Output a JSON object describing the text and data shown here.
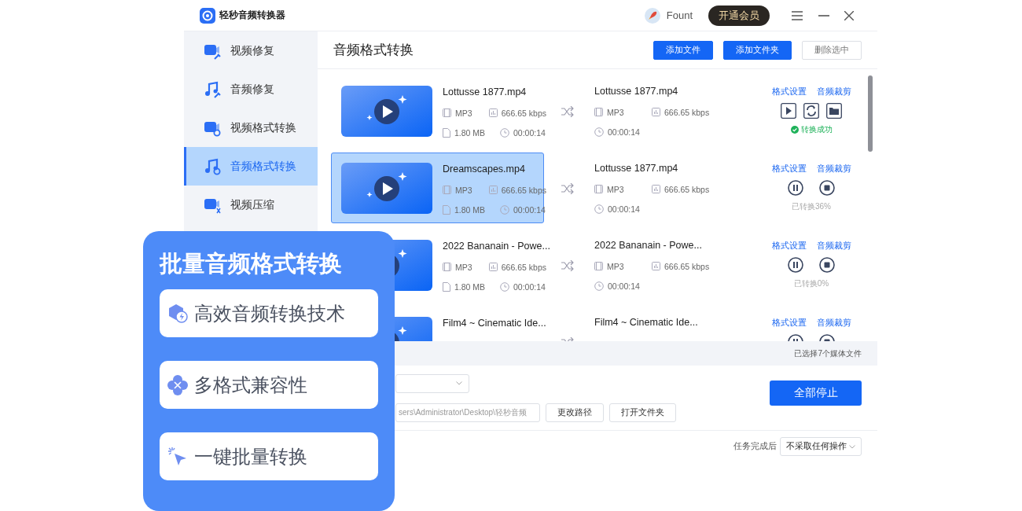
{
  "app": {
    "title": "轻秒音频转换器",
    "user": "Fount",
    "vip_button": "开通会员"
  },
  "sidebar": {
    "items": [
      {
        "label": "视频修复",
        "kind": "video-repair",
        "selected": false
      },
      {
        "label": "音频修复",
        "kind": "audio-repair",
        "selected": false
      },
      {
        "label": "视频格式转换",
        "kind": "video-convert",
        "selected": false
      },
      {
        "label": "音频格式转换",
        "kind": "audio-convert",
        "selected": true
      },
      {
        "label": "视频压缩",
        "kind": "video-compress",
        "selected": false
      }
    ]
  },
  "main": {
    "title": "音频格式转换",
    "buttons": [
      {
        "label": "添加文件",
        "kind": "primary"
      },
      {
        "label": "添加文件夹",
        "kind": "primary"
      },
      {
        "label": "删除选中",
        "kind": "outline"
      }
    ]
  },
  "files": [
    {
      "name": "Lottusse 1877.mp4",
      "format": "MP3",
      "bitrate": "666.65 kbps",
      "size": "1.80 MB",
      "duration": "00:00:14",
      "output_name": "Lottusse 1877.mp4",
      "output_format": "MP3",
      "output_bitrate": "666.65 kbps",
      "output_duration": "00:00:14",
      "links": [
        "格式设置",
        "音频裁剪"
      ],
      "kind": "done",
      "status": "转换成功",
      "selected": false
    },
    {
      "name": "Dreamscapes.mp4",
      "format": "MP3",
      "bitrate": "666.65 kbps",
      "size": "1.80 MB",
      "duration": "00:00:14",
      "output_name": "Lottusse 1877.mp4",
      "output_format": "MP3",
      "output_bitrate": "666.65 kbps",
      "output_duration": "00:00:14",
      "links": [
        "格式设置",
        "音频裁剪"
      ],
      "kind": "converting",
      "status": "已转换36%",
      "selected": true
    },
    {
      "name": "2022 Bananain - Powe...",
      "format": "MP3",
      "bitrate": "666.65 kbps",
      "size": "1.80 MB",
      "duration": "00:00:14",
      "output_name": "2022 Bananain - Powe...",
      "output_format": "MP3",
      "output_bitrate": "666.65 kbps",
      "output_duration": "00:00:14",
      "links": [
        "格式设置",
        "音频裁剪"
      ],
      "kind": "converting",
      "status": "已转换0%",
      "selected": false
    },
    {
      "name": "Film4 ~ Cinematic Ide...",
      "output_name": "Film4 ~ Cinematic Ide...",
      "links": [
        "格式设置",
        "音频裁剪"
      ],
      "kind": "converting",
      "selected": false
    }
  ],
  "selection_count": "已选择7个媒体文件",
  "output": {
    "path": "sers\\Administrator\\Desktop\\轻秒音频",
    "buttons": [
      "更改路径",
      "打开文件夹"
    ]
  },
  "stop_all_button": "全部停止",
  "after_task": {
    "label": "任务完成后",
    "value": "不采取任何操作"
  },
  "promo": {
    "title": "批量音频格式转换",
    "features": [
      {
        "label": "高效音频转换技术",
        "kind": "speed"
      },
      {
        "label": "多格式兼容性",
        "kind": "formats"
      },
      {
        "label": "一键批量转换",
        "kind": "click"
      }
    ]
  }
}
